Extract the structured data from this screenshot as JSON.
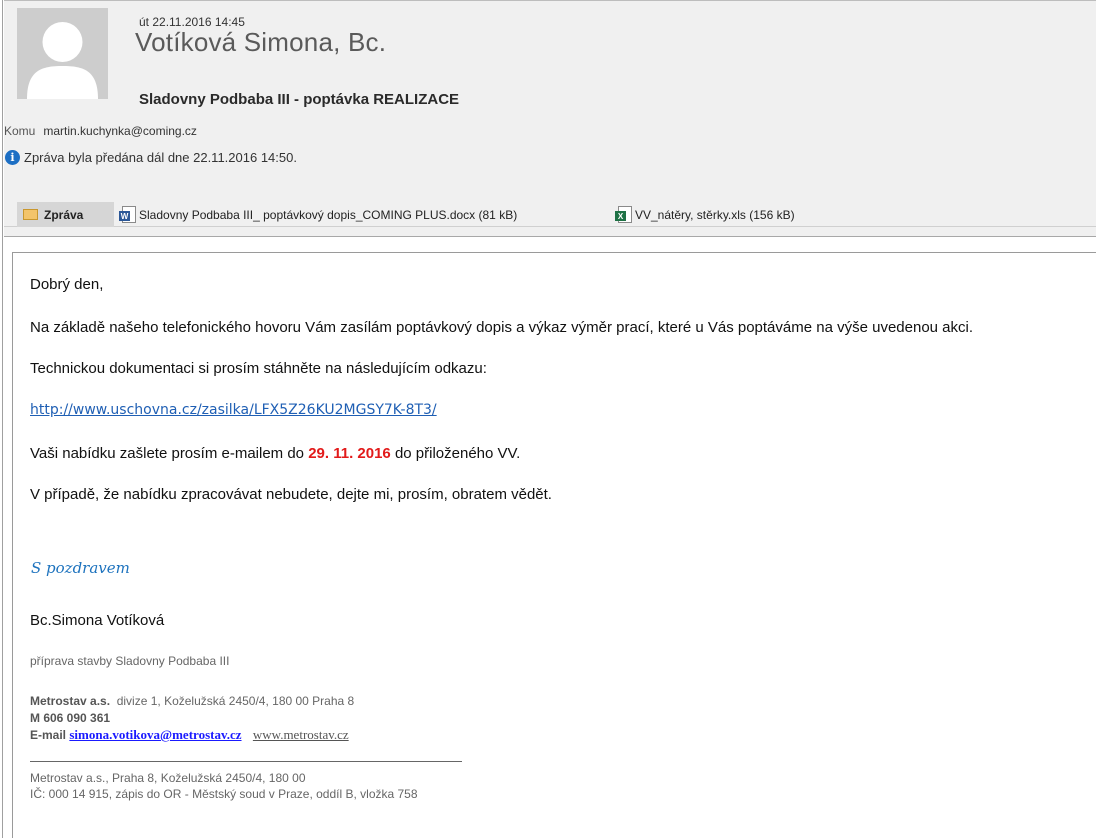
{
  "header": {
    "date": "út 22.11.2016 14:45",
    "sender": "Votíková Simona, Bc.",
    "subject": "Sladovny Podbaba III - poptávka REALIZACE",
    "to_label": "Komu",
    "to_value": "martin.kuchynka@coming.cz",
    "forward_notice": "Zpráva byla předána dál dne 22.11.2016 14:50."
  },
  "attachments": {
    "message_tab": "Zpráva",
    "files": [
      {
        "name": "Sladovny Podbaba III_ poptávkový dopis_COMING PLUS.docx (81 kB)",
        "icon": "word-doc-icon"
      },
      {
        "name": "VV_nátěry, stěrky.xls (156 kB)",
        "icon": "excel-doc-icon"
      }
    ]
  },
  "body": {
    "greeting_line": "Dobrý den,",
    "line1": "Na základě našeho telefonického hovoru Vám zasílám poptávkový dopis a výkaz výměr prací, které u Vás poptáváme na výše uvedenou akci.",
    "line2": "Technickou dokumentaci si prosím stáhněte na následujícím odkazu:",
    "link": "http://www.uschovna.cz/zasilka/LFX5Z26KU2MGSY7K-8T3/",
    "line4_pre": "Vaši nabídku zašlete prosím e-mailem do ",
    "line4_date": "29. 11. 2016",
    "line4_post": " do přiloženého VV.",
    "line5": "V případě, že nabídku zpracovávat nebudete, dejte mi, prosím, obratem vědět."
  },
  "signature": {
    "closing": "S pozdravem",
    "name": "Bc.Simona Votíková",
    "role": "příprava stavby Sladovny Podbaba III",
    "company": "Metrostav a.s.",
    "company_address": "divize 1,  Koželužská 2450/4,  180 00  Praha 8",
    "mobile": "M 606 090 361",
    "email_label": "E-mail",
    "email": "simona.votikova@metrostav.cz",
    "web": "www.metrostav.cz",
    "footer1": "Metrostav a.s., Praha 8, Koželužská 2450/4, 180 00",
    "footer2": "IČ: 000 14 915, zápis do OR - Městský soud v Praze, oddíl B, vložka 758"
  },
  "colors": {
    "accent_link": "#1f5fb4",
    "deadline_red": "#e21a1a",
    "closing_blue": "#1e73be"
  }
}
